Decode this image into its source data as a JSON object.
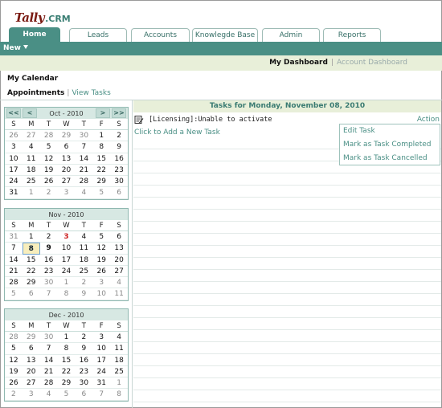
{
  "logo": {
    "brand": "Tally",
    "product": ".CRM"
  },
  "tabs": [
    {
      "label": "Home",
      "active": true
    },
    {
      "label": "Leads",
      "active": false
    },
    {
      "label": "Accounts",
      "active": false
    },
    {
      "label": "Knowlegde Base",
      "active": false
    },
    {
      "label": "Admin",
      "active": false
    },
    {
      "label": "Reports",
      "active": false
    }
  ],
  "menu": {
    "new_label": "New"
  },
  "dashboard": {
    "active": "My Dashboard",
    "inactive": "Account Dashboard",
    "separator": "|"
  },
  "calendar_title": "My Calendar",
  "subtabs": {
    "active": "Appointments",
    "link": "View Tasks",
    "separator": "|"
  },
  "weekdays": [
    "S",
    "M",
    "T",
    "W",
    "T",
    "F",
    "S"
  ],
  "calendars": [
    {
      "label": "Oct - 2010",
      "nav": {
        "prev_year": "<<",
        "prev": "<",
        "next": ">",
        "next_year": ">>"
      },
      "days": [
        "26",
        "27",
        "28",
        "29",
        "30",
        "1",
        "2",
        "3",
        "4",
        "5",
        "6",
        "7",
        "8",
        "9",
        "10",
        "11",
        "12",
        "13",
        "14",
        "15",
        "16",
        "17",
        "18",
        "19",
        "20",
        "21",
        "22",
        "23",
        "24",
        "25",
        "26",
        "27",
        "28",
        "29",
        "30",
        "31",
        "1",
        "2",
        "3",
        "4",
        "5",
        "6"
      ],
      "other_month": [
        0,
        1,
        2,
        3,
        4,
        36,
        37,
        38,
        39,
        40,
        41
      ]
    },
    {
      "label": "Nov - 2010",
      "days": [
        "31",
        "1",
        "2",
        "3",
        "4",
        "5",
        "6",
        "7",
        "8",
        "9",
        "10",
        "11",
        "12",
        "13",
        "14",
        "15",
        "16",
        "17",
        "18",
        "19",
        "20",
        "21",
        "22",
        "23",
        "24",
        "25",
        "26",
        "27",
        "28",
        "29",
        "30",
        "1",
        "2",
        "3",
        "4",
        "5",
        "6",
        "7",
        "8",
        "9",
        "10",
        "11"
      ],
      "other_month": [
        0,
        30,
        31,
        32,
        33,
        34,
        35,
        36,
        37,
        38,
        39,
        40,
        41
      ],
      "today": 8,
      "highlighted": 3,
      "bold": 9
    },
    {
      "label": "Dec - 2010",
      "days": [
        "28",
        "29",
        "30",
        "1",
        "2",
        "3",
        "4",
        "5",
        "6",
        "7",
        "8",
        "9",
        "10",
        "11",
        "12",
        "13",
        "14",
        "15",
        "16",
        "17",
        "18",
        "19",
        "20",
        "21",
        "22",
        "23",
        "24",
        "25",
        "26",
        "27",
        "28",
        "29",
        "30",
        "31",
        "1",
        "2",
        "3",
        "4",
        "5",
        "6",
        "7",
        "8"
      ],
      "other_month": [
        0,
        1,
        2,
        34,
        35,
        36,
        37,
        38,
        39,
        40,
        41
      ]
    }
  ],
  "tasks": {
    "heading": "Tasks for Monday, November 08, 2010",
    "items": [
      {
        "text": "[Licensing]:Unable to activate",
        "action": "Action"
      }
    ],
    "add_link": "Click to Add a New Task",
    "popup": [
      "Edit Task",
      "Mark as Task Completed",
      "Mark as Task Cancelled"
    ]
  }
}
